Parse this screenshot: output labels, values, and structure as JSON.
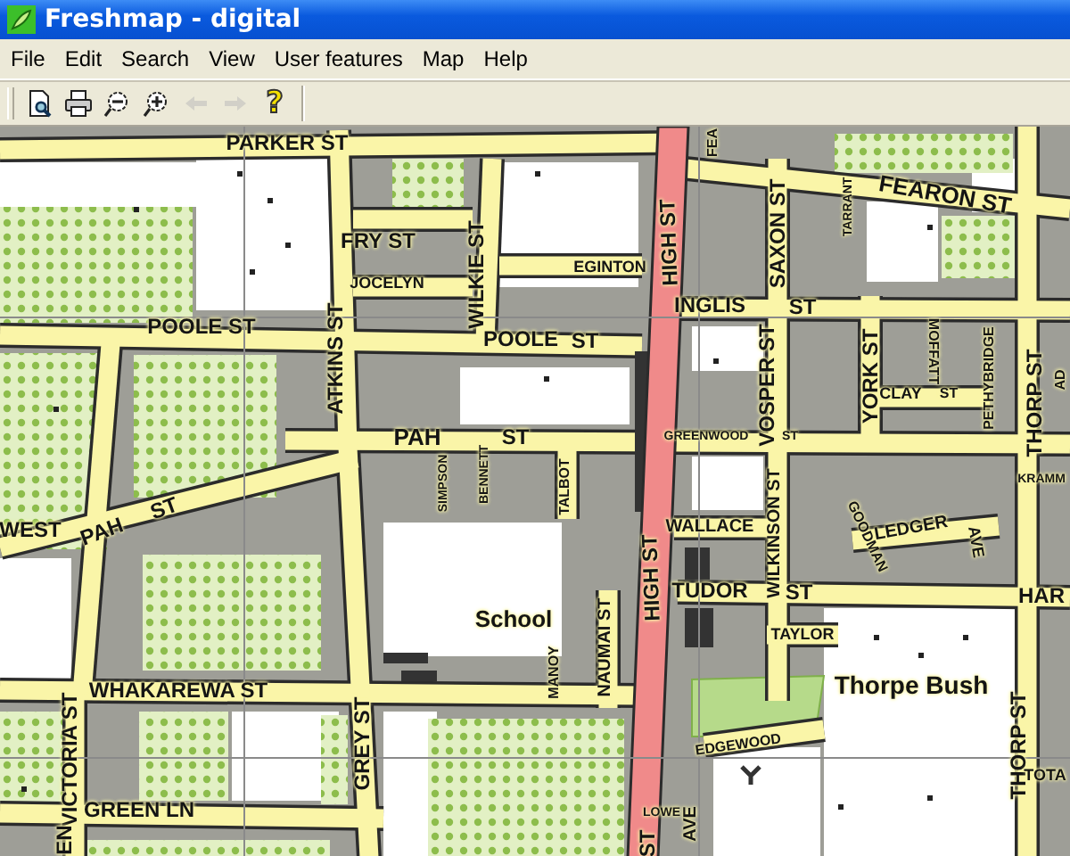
{
  "window": {
    "title": "Freshmap - digital"
  },
  "menu": [
    {
      "label": "File"
    },
    {
      "label": "Edit"
    },
    {
      "label": "Search"
    },
    {
      "label": "View"
    },
    {
      "label": "User features"
    },
    {
      "label": "Map"
    },
    {
      "label": "Help"
    }
  ],
  "toolbar": [
    {
      "kind": "preview",
      "disabled": false
    },
    {
      "kind": "print",
      "disabled": false
    },
    {
      "kind": "zoom-out",
      "disabled": false
    },
    {
      "kind": "zoom-in",
      "disabled": false
    },
    {
      "kind": "back",
      "disabled": true
    },
    {
      "kind": "forward",
      "disabled": true
    },
    {
      "kind": "help",
      "glyph": "?",
      "disabled": false
    }
  ],
  "map": {
    "labels": [
      {
        "text": "PARKER ST"
      },
      {
        "text": "FEA"
      },
      {
        "text": "FEARON ST"
      },
      {
        "text": "FRY ST"
      },
      {
        "text": "EGINTON"
      },
      {
        "text": "WILKIE ST"
      },
      {
        "text": "HIGH ST"
      },
      {
        "text": "SAXON ST"
      },
      {
        "text": "TARRANT"
      },
      {
        "text": "JOCELYN"
      },
      {
        "text": "INGLIS"
      },
      {
        "text": "ST"
      },
      {
        "text": "POOLE ST"
      },
      {
        "text": "POOLE"
      },
      {
        "text": "ST"
      },
      {
        "text": "ATKINS ST"
      },
      {
        "text": "VOSPER ST"
      },
      {
        "text": "YORK ST"
      },
      {
        "text": "MOFFATT"
      },
      {
        "text": "CLAY"
      },
      {
        "text": "ST"
      },
      {
        "text": "PETHYBRIDGE"
      },
      {
        "text": "THORP ST"
      },
      {
        "text": "AD"
      },
      {
        "text": "PAH"
      },
      {
        "text": "ST"
      },
      {
        "text": "GREENWOOD"
      },
      {
        "text": "ST"
      },
      {
        "text": "SIMPSON"
      },
      {
        "text": "BENNETT"
      },
      {
        "text": "TALBOT"
      },
      {
        "text": "KRAMM"
      },
      {
        "text": "WEST"
      },
      {
        "text": "PAH"
      },
      {
        "text": "ST"
      },
      {
        "text": "WALLACE"
      },
      {
        "text": "WILKINSON ST"
      },
      {
        "text": "GOODMAN"
      },
      {
        "text": "LEDGER"
      },
      {
        "text": "AVE"
      },
      {
        "text": "TUDOR"
      },
      {
        "text": "ST"
      },
      {
        "text": "HAR"
      },
      {
        "text": "HIGH ST"
      },
      {
        "text": "School"
      },
      {
        "text": "NAUMAI ST"
      },
      {
        "text": "TAYLOR"
      },
      {
        "text": "MANOY"
      },
      {
        "text": "WHAKAREWA ST"
      },
      {
        "text": "Thorpe Bush"
      },
      {
        "text": "VICTORIA ST"
      },
      {
        "text": "GREY ST"
      },
      {
        "text": "EDGEWOOD"
      },
      {
        "text": "THORP ST"
      },
      {
        "text": "TOTA"
      },
      {
        "text": "GREEN LN"
      },
      {
        "text": "LOWE"
      },
      {
        "text": "AVE"
      },
      {
        "text": "ST"
      },
      {
        "text": "EN"
      }
    ]
  }
}
